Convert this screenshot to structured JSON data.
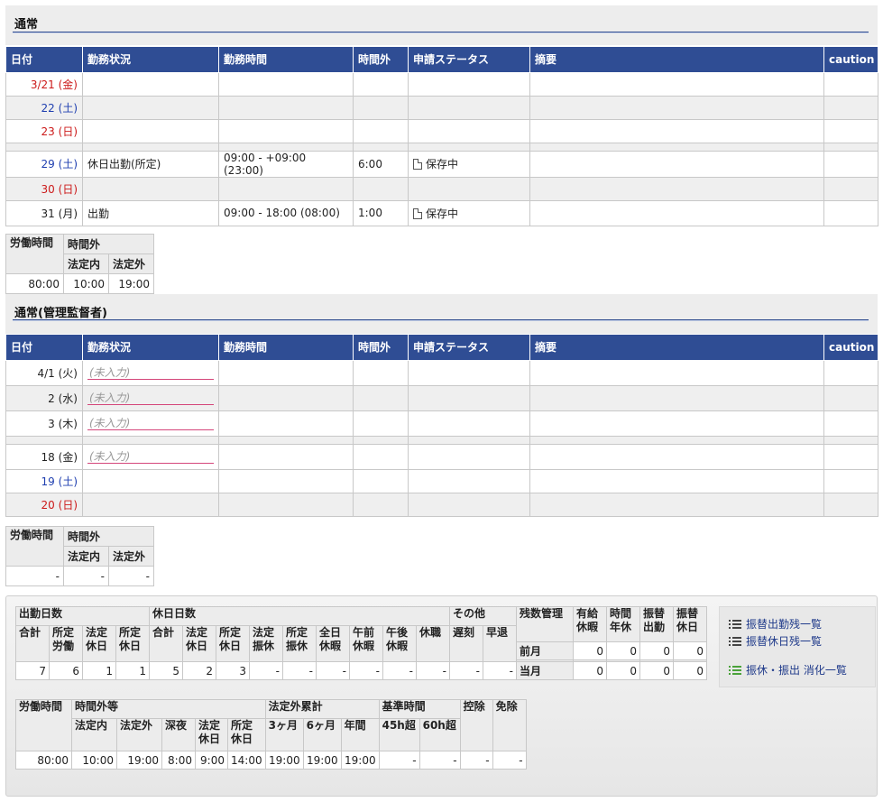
{
  "sections": [
    {
      "title": "通常",
      "columns": [
        "日付",
        "勤務状況",
        "勤務時間",
        "時間外",
        "申請ステータス",
        "摘要",
        "caution"
      ],
      "rows": [
        {
          "date": "3/21 (金)",
          "day_class": "sun",
          "status": "",
          "hours": "",
          "overtime": "",
          "approval": "",
          "note": "",
          "caution": ""
        },
        {
          "date": "22 (土)",
          "day_class": "sat",
          "status": "",
          "hours": "",
          "overtime": "",
          "approval": "",
          "note": "",
          "caution": ""
        },
        {
          "date": "23 (日)",
          "day_class": "sun",
          "status": "",
          "hours": "",
          "overtime": "",
          "approval": "",
          "note": "",
          "caution": ""
        },
        {
          "date": "29 (土)",
          "day_class": "sat",
          "status": "休日出勤(所定)",
          "hours": "09:00 - +09:00 (23:00)",
          "overtime": "6:00",
          "approval": "保存中",
          "note": "",
          "caution": ""
        },
        {
          "date": "30 (日)",
          "day_class": "sun",
          "status": "",
          "hours": "",
          "overtime": "",
          "approval": "",
          "note": "",
          "caution": ""
        },
        {
          "date": "31 (月)",
          "day_class": "wk",
          "status": "出勤",
          "hours": "09:00 - 18:00 (08:00)",
          "overtime": "1:00",
          "approval": "保存中",
          "note": "",
          "caution": ""
        }
      ],
      "summary": {
        "labor_label": "労働時間",
        "overtime_label": "時間外",
        "legal_in_label": "法定内",
        "legal_out_label": "法定外",
        "labor": "80:00",
        "legal_in": "10:00",
        "legal_out": "19:00"
      }
    },
    {
      "title": "通常(管理監督者)",
      "columns": [
        "日付",
        "勤務状況",
        "勤務時間",
        "時間外",
        "申請ステータス",
        "摘要",
        "caution"
      ],
      "placeholder": "(未入力)",
      "rows": [
        {
          "date": "4/1 (火)",
          "day_class": "wk"
        },
        {
          "date": "2 (水)",
          "day_class": "wk"
        },
        {
          "date": "3 (木)",
          "day_class": "wk"
        },
        {
          "date": "18 (金)",
          "day_class": "wk"
        },
        {
          "date": "19 (土)",
          "day_class": "sat"
        },
        {
          "date": "20 (日)",
          "day_class": "sun"
        }
      ],
      "summary": {
        "labor_label": "労働時間",
        "overtime_label": "時間外",
        "legal_in_label": "法定内",
        "legal_out_label": "法定外",
        "labor": "-",
        "legal_in": "-",
        "legal_out": "-"
      }
    }
  ],
  "attendance_stats": {
    "groups": {
      "work_days": "出勤日数",
      "holiday_days": "休日日数",
      "other": "その他",
      "balance": "残数管理"
    },
    "work_cols": [
      "合計",
      "所定労働",
      "法定休日",
      "所定休日"
    ],
    "work_vals": [
      "7",
      "6",
      "1",
      "1"
    ],
    "holiday_cols": [
      "合計",
      "法定休日",
      "所定休日",
      "法定振休",
      "所定振休",
      "全日休暇",
      "午前休暇",
      "午後休暇",
      "休職"
    ],
    "holiday_vals": [
      "5",
      "2",
      "3",
      "-",
      "-",
      "-",
      "-",
      "-",
      "-"
    ],
    "other_cols": [
      "遅刻",
      "早退"
    ],
    "other_vals": [
      "-",
      "-"
    ],
    "balance_cols": [
      "有給休暇",
      "時間年休",
      "振替出勤",
      "振替休日"
    ],
    "balance_rows": [
      {
        "label": "前月",
        "vals": [
          "0",
          "0",
          "0",
          "0"
        ]
      },
      {
        "label": "当月",
        "vals": [
          "0",
          "0",
          "0",
          "0"
        ]
      }
    ]
  },
  "hours_stats": {
    "labor_label": "労働時間",
    "overtime_group": "時間外等",
    "overtime_cols": [
      "法定内",
      "法定外",
      "深夜",
      "法定休日",
      "所定休日"
    ],
    "cumulative_group": "法定外累計",
    "cumulative_cols": [
      "3ヶ月",
      "6ヶ月",
      "年間"
    ],
    "standard_group": "基準時間",
    "standard_cols": [
      "45h超",
      "60h超"
    ],
    "deduction_label": "控除",
    "exemption_label": "免除",
    "values": [
      "80:00",
      "10:00",
      "19:00",
      "8:00",
      "9:00",
      "14:00",
      "19:00",
      "19:00",
      "19:00",
      "-",
      "-",
      "-",
      "-"
    ]
  },
  "links": [
    {
      "label": "振替出勤残一覧",
      "icon": "list-icon",
      "color": "#444444"
    },
    {
      "label": "振替休日残一覧",
      "icon": "list-icon",
      "color": "#444444"
    },
    {
      "label": "振休・振出 消化一覧",
      "icon": "list-icon",
      "color": "#4aa23a"
    }
  ],
  "colors": {
    "header": "#2f4d94",
    "saturday": "#1f3fb0",
    "sunday": "#cc1a1a",
    "placeholder_underline": "#d4467a"
  }
}
